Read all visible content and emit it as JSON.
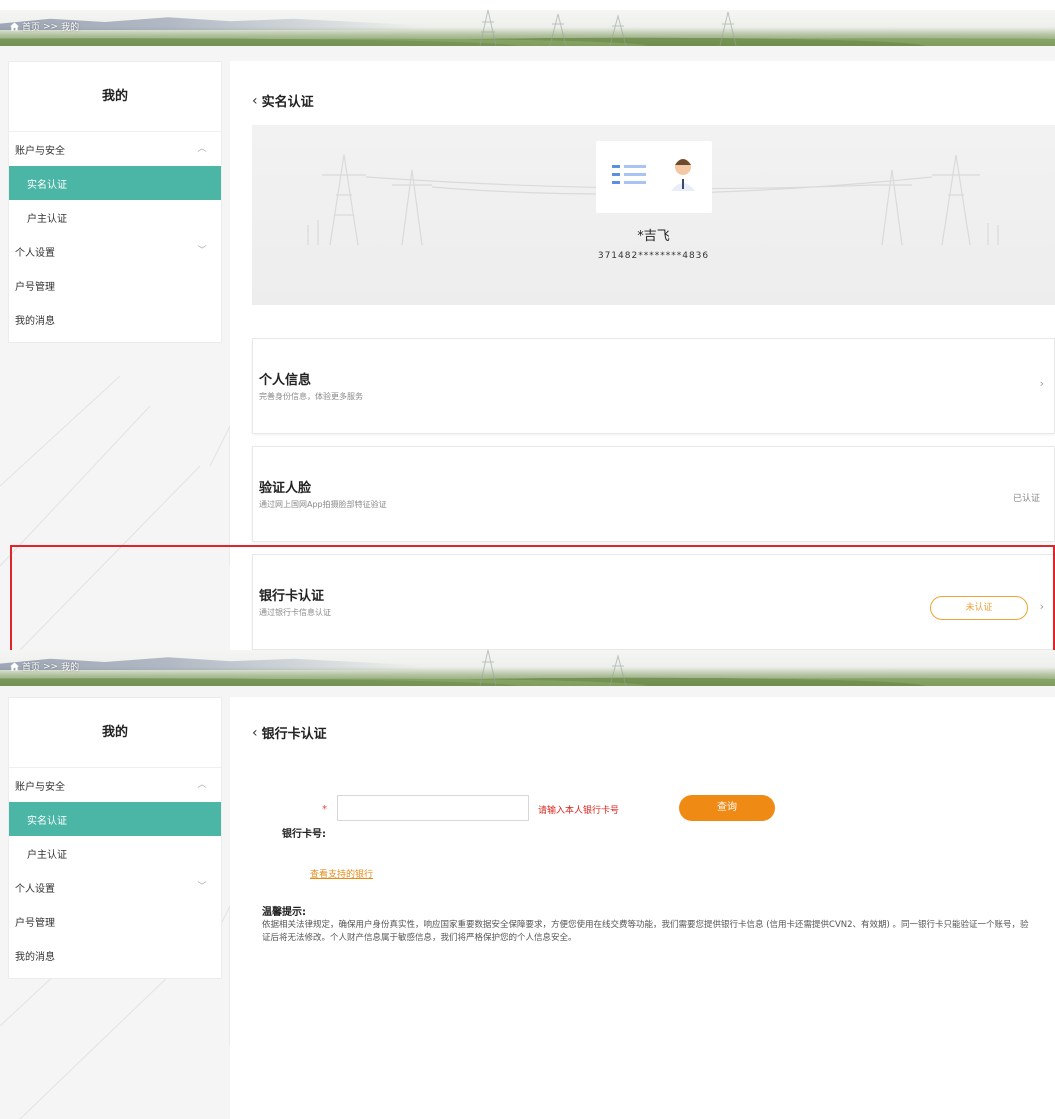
{
  "screen1": {
    "breadcrumb": {
      "home": "首页",
      "sep": ">>",
      "current": "我的"
    },
    "sidebar": {
      "title": "我的",
      "items": [
        {
          "label": "账户与安全",
          "chevron": "up"
        },
        {
          "label": "实名认证",
          "active": true
        },
        {
          "label": "户主认证"
        },
        {
          "label": "个人设置",
          "chevron": "down"
        },
        {
          "label": "户号管理"
        },
        {
          "label": "我的消息"
        }
      ]
    },
    "page_title": "实名认证",
    "identity": {
      "name": "*吉飞",
      "id_number": "371482********4836"
    },
    "cards": [
      {
        "title": "个人信息",
        "subtitle": "完善身份信息，体验更多服务",
        "status": "",
        "arrow": "›"
      },
      {
        "title": "验证人脸",
        "subtitle": "通过网上国网App拍摄脸部特征验证",
        "status": "已认证",
        "arrow": ""
      },
      {
        "title": "银行卡认证",
        "subtitle": "通过银行卡信息认证",
        "status": "未认证",
        "arrow": "›"
      }
    ]
  },
  "screen2": {
    "breadcrumb": {
      "home": "首页",
      "sep": ">>",
      "current": "我的"
    },
    "sidebar": {
      "title": "我的",
      "items": [
        {
          "label": "账户与安全",
          "chevron": "up"
        },
        {
          "label": "实名认证",
          "active": true
        },
        {
          "label": "户主认证"
        },
        {
          "label": "个人设置",
          "chevron": "down"
        },
        {
          "label": "户号管理"
        },
        {
          "label": "我的消息"
        }
      ]
    },
    "page_title": "银行卡认证",
    "form": {
      "required_mark": "*",
      "card_label": "银行卡号:",
      "card_value": "",
      "card_placeholder": "",
      "error_hint": "请输入本人银行卡号",
      "query_button": "查询",
      "supported_banks_link": "查看支持的银行"
    },
    "tips": {
      "title": "温馨提示:",
      "text": "依据相关法律规定，确保用户身份真实性，响应国家重要数据安全保障要求，方便您使用在线交费等功能，我们需要您提供银行卡信息 (信用卡还需提供CVN2、有效期) 。同一银行卡只能验证一个账号，验证后将无法修改。个人财产信息属于敏感信息，我们将严格保护您的个人信息安全。"
    }
  },
  "colors": {
    "accent": "#4bb6a6",
    "orange": "#ef8a15",
    "highlight": "#e0242a",
    "error": "#d9261c"
  }
}
